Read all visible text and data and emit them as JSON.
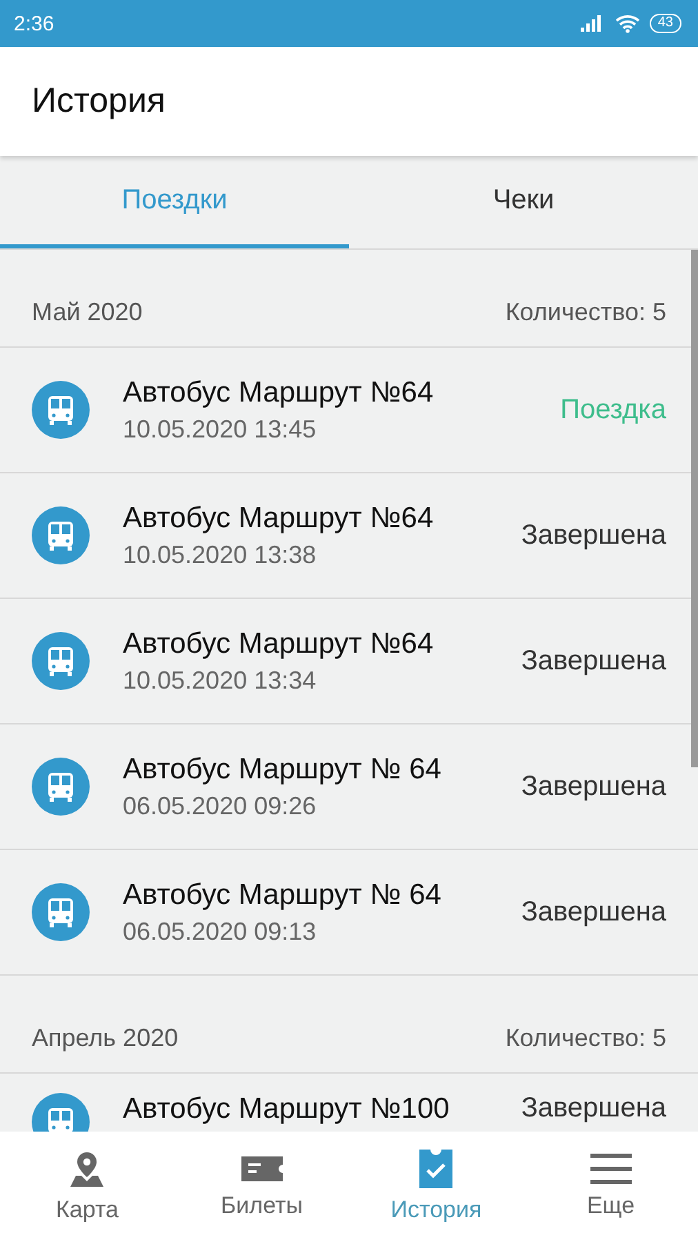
{
  "status_bar": {
    "time": "2:36",
    "battery": "43"
  },
  "header": {
    "title": "История"
  },
  "tabs": [
    {
      "label": "Поездки",
      "selected": true
    },
    {
      "label": "Чеки",
      "selected": false
    }
  ],
  "sections": [
    {
      "month": "Май  2020",
      "count": "Количество: 5",
      "trips": [
        {
          "route": "Автобус Маршрут №64",
          "datetime": "10.05.2020 13:45",
          "status": "Поездка",
          "kind": "active"
        },
        {
          "route": "Автобус Маршрут №64",
          "datetime": "10.05.2020 13:38",
          "status": "Завершена",
          "kind": "done"
        },
        {
          "route": "Автобус Маршрут №64",
          "datetime": "10.05.2020 13:34",
          "status": "Завершена",
          "kind": "done"
        },
        {
          "route": "Автобус Маршрут № 64",
          "datetime": "06.05.2020 09:26",
          "status": "Завершена",
          "kind": "done"
        },
        {
          "route": "Автобус Маршрут № 64",
          "datetime": "06.05.2020 09:13",
          "status": "Завершена",
          "kind": "done"
        }
      ]
    },
    {
      "month": "Апрель  2020",
      "count": "Количество: 5",
      "trips": [
        {
          "route": "Автобус Маршрут №100",
          "status": "Завершена",
          "kind": "done"
        }
      ]
    }
  ],
  "nav": [
    {
      "label": "Карта",
      "selected": false
    },
    {
      "label": "Билеты",
      "selected": false
    },
    {
      "label": "История",
      "selected": true
    },
    {
      "label": "Еще",
      "selected": false
    }
  ]
}
